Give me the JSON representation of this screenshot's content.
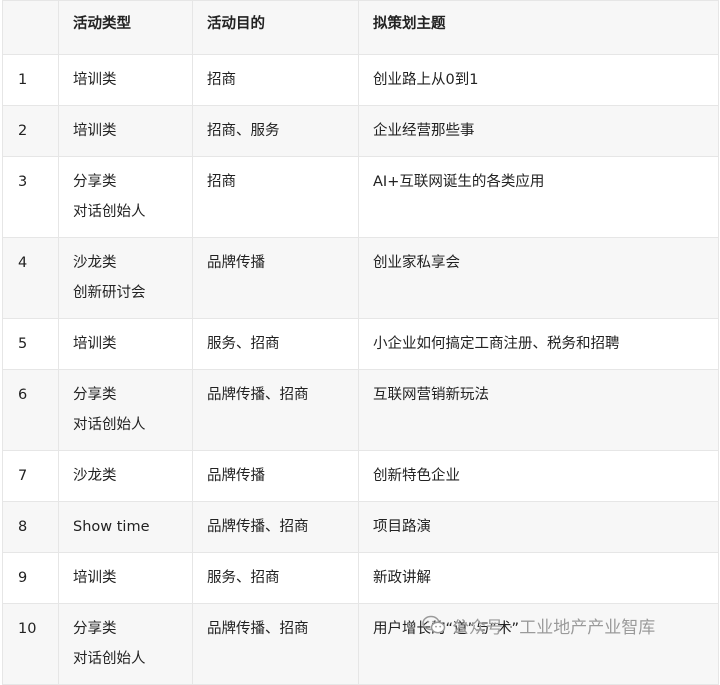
{
  "table": {
    "headers": [
      "",
      "活动类型",
      "活动目的",
      "拟策划主题"
    ],
    "rows": [
      {
        "no": "1",
        "type": [
          "培训类"
        ],
        "purpose": "招商",
        "theme": "创业路上从0到1"
      },
      {
        "no": "2",
        "type": [
          "培训类"
        ],
        "purpose": "招商、服务",
        "theme": "企业经营那些事"
      },
      {
        "no": "3",
        "type": [
          "分享类",
          "对话创始人"
        ],
        "purpose": "招商",
        "theme": "AI+互联网诞生的各类应用"
      },
      {
        "no": "4",
        "type": [
          "沙龙类",
          "创新研讨会"
        ],
        "purpose": "品牌传播",
        "theme": "创业家私享会"
      },
      {
        "no": "5",
        "type": [
          "培训类"
        ],
        "purpose": "服务、招商",
        "theme": "小企业如何搞定工商注册、税务和招聘"
      },
      {
        "no": "6",
        "type": [
          "分享类",
          "对话创始人"
        ],
        "purpose": "品牌传播、招商",
        "theme": "互联网营销新玩法"
      },
      {
        "no": "7",
        "type": [
          "沙龙类"
        ],
        "purpose": "品牌传播",
        "theme": "创新特色企业"
      },
      {
        "no": "8",
        "type": [
          "Show time"
        ],
        "purpose": "品牌传播、招商",
        "theme": "项目路演"
      },
      {
        "no": "9",
        "type": [
          "培训类"
        ],
        "purpose": "服务、招商",
        "theme": "新政讲解"
      },
      {
        "no": "10",
        "type": [
          "分享类",
          "对话创始人"
        ],
        "purpose": "品牌传播、招商",
        "theme": "用户增长的“道”与“术”"
      }
    ]
  },
  "watermark": {
    "text": "公众号 · 工业地产产业智库",
    "icon": "wechat-icon"
  },
  "colors": {
    "stripe": "#f7f7f7",
    "border": "#e6e6e6",
    "text": "#222222",
    "watermark": "#9a9a9a"
  }
}
